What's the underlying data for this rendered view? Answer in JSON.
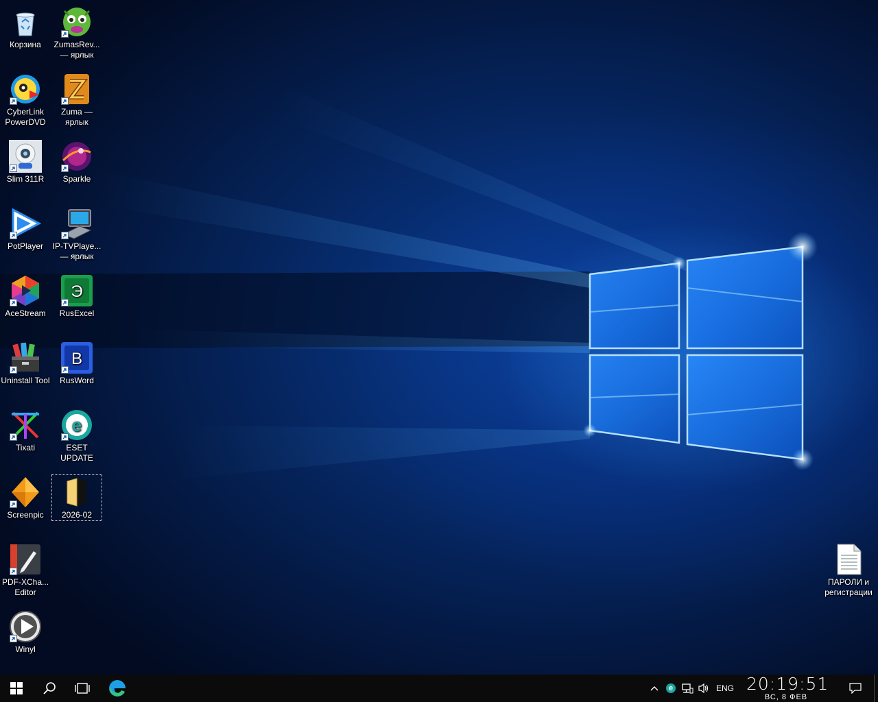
{
  "desktop": {
    "icons": [
      {
        "label": "Корзина",
        "icon": "recycle-bin-icon"
      },
      {
        "label": "ZumasRev... — ярлык",
        "icon": "zuma-revenge-icon"
      },
      {
        "label": "CyberLink PowerDVD",
        "icon": "powerdvd-icon"
      },
      {
        "label": "Zuma — ярлык",
        "icon": "zuma-icon"
      },
      {
        "label": "Slim 311R",
        "icon": "webcam-icon"
      },
      {
        "label": "Sparkle",
        "icon": "sparkle-icon"
      },
      {
        "label": "PotPlayer",
        "icon": "potplayer-icon"
      },
      {
        "label": "IP-TVPlaye... — ярлык",
        "icon": "iptv-player-icon"
      },
      {
        "label": "AceStream",
        "icon": "acestream-icon"
      },
      {
        "label": "RusExcel",
        "icon": "rusexcel-icon"
      },
      {
        "label": "Uninstall Tool",
        "icon": "uninstall-tool-icon"
      },
      {
        "label": "RusWord",
        "icon": "rusword-icon"
      },
      {
        "label": "Tixati",
        "icon": "tixati-icon"
      },
      {
        "label": "ESET UPDATE",
        "icon": "eset-icon"
      },
      {
        "label": "Screenpic",
        "icon": "screenpic-icon"
      },
      {
        "label": "2026-02",
        "icon": "folder-icon"
      },
      {
        "label": "PDF-XCha... Editor",
        "icon": "pdf-xchange-icon"
      },
      {
        "label": "Winyl",
        "icon": "winyl-icon"
      },
      {
        "label": "ПАРОЛИ и регистрации",
        "icon": "text-document-icon"
      }
    ],
    "rusexcel_glyph": "Э",
    "rusword_glyph": "В",
    "eset_glyph": "e"
  },
  "taskbar": {
    "start_icon": "windows-start-icon",
    "search_icon": "search-icon",
    "task_view_icon": "task-view-icon",
    "pinned_app_icon": "edge-icon",
    "tray": {
      "chevron_icon": "chevron-up-icon",
      "eset_tray_glyph": "e",
      "network_icon": "network-icon",
      "volume_icon": "volume-icon",
      "language": "ENG"
    },
    "clock": {
      "time": "20:19:51",
      "date": "ВС, 8 ФЕВ"
    },
    "notifications_icon": "action-center-icon"
  },
  "colors": {
    "taskbar_bg": "#0b0b0b",
    "wallpaper_blue": "#0b3f93",
    "window_light": "#7fd0ff"
  }
}
